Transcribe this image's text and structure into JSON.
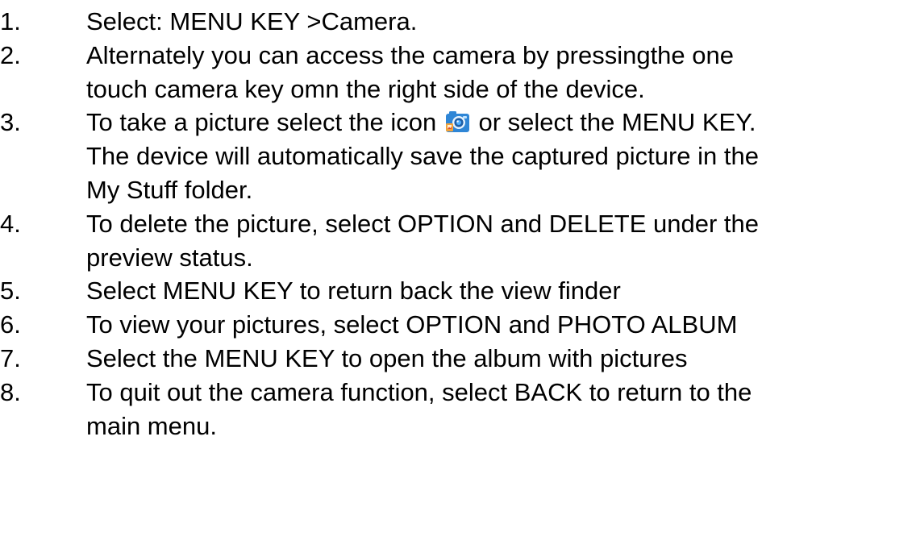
{
  "steps": [
    {
      "number": "1.",
      "lines": [
        "Select: MENU KEY >Camera."
      ]
    },
    {
      "number": "2.",
      "lines": [
        "Alternately you can access the camera by pressingthe one",
        "touch camera key omn the right side of the device."
      ]
    },
    {
      "number": "3.",
      "line1_before_icon": "To take a picture select the icon",
      "line1_after_icon": "or select the MENU KEY.",
      "icon": "camera-icon",
      "lines_rest": [
        "The device will automatically save the captured picture in the",
        "My Stuff folder."
      ]
    },
    {
      "number": "4.",
      "lines": [
        "To delete the picture, select OPTION and DELETE under the",
        "preview status."
      ]
    },
    {
      "number": "5.",
      "lines": [
        "Select MENU KEY to return back the view finder"
      ]
    },
    {
      "number": "6.",
      "lines": [
        "To view your pictures, select OPTION and PHOTO ALBUM"
      ]
    },
    {
      "number": "7.",
      "lines": [
        "Select the MENU KEY to open the album with pictures"
      ]
    },
    {
      "number": "8.",
      "lines": [
        "To quit out the camera function, select BACK to return to the",
        "main menu."
      ]
    }
  ],
  "colors": {
    "text": "#000000",
    "background": "#ffffff",
    "icon_body": "#2f86d6",
    "icon_accent": "#f2a33a"
  }
}
